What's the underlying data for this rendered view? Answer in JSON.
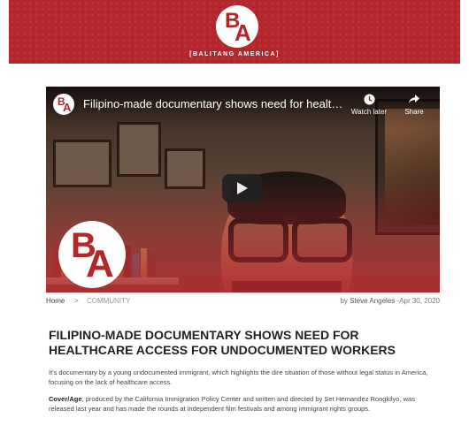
{
  "header": {
    "brand": "[BALITANG AMERICA]",
    "logo_b": "B",
    "logo_a": "A",
    "bg_color": "#b3262b"
  },
  "video": {
    "title": "Filipino-made documentary shows need for health care ...",
    "watch_later_label": "Watch later",
    "share_label": "Share",
    "watch_later_icon": "clock-icon",
    "share_icon": "share-arrow-icon",
    "play_icon": "play-icon"
  },
  "breadcrumb": {
    "home": "Home",
    "separator": ">",
    "category": "COMMUNITY",
    "by": "by",
    "author": "Steve Angeles",
    "date": "-Apr 30, 2020"
  },
  "article": {
    "title": "FILIPINO-MADE DOCUMENTARY SHOWS NEED FOR HEALTHCARE ACCESS FOR UNDOCUMENTED WORKERS",
    "para1": "It's documentary by a young undocumented immigrant, which highlights the dire situation of those without legal status in America, focusing on the lack of healthcare access.",
    "para2_bold": "Cover/Age",
    "para2_rest": ", produced by the California Immigration Policy Center and written and directed by Set Hernandez Rongkilyo, was released last year and has made the rounds at independent film festivals and among immigrant rights groups."
  }
}
